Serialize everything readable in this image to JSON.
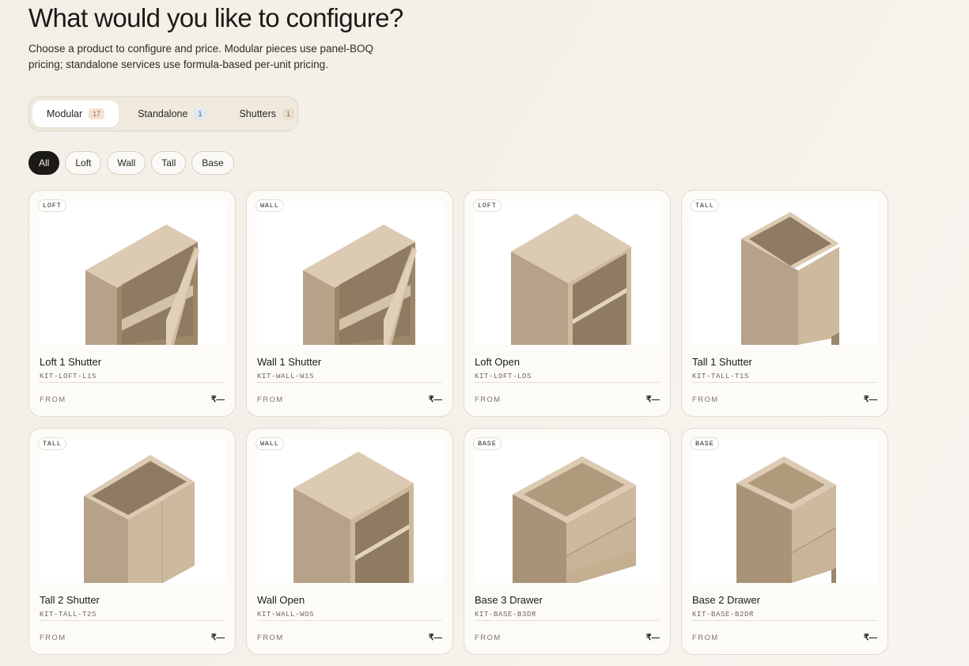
{
  "header": {
    "title": "What would you like to configure?",
    "subtitle": "Choose a product to configure and price. Modular pieces use panel-BOQ pricing; standalone services use formula-based per-unit pricing."
  },
  "tabs": [
    {
      "label": "Modular",
      "count": "17",
      "active": true
    },
    {
      "label": "Standalone",
      "count": "1",
      "active": false
    },
    {
      "label": "Shutters",
      "count": "1",
      "active": false
    }
  ],
  "filters": [
    {
      "label": "All",
      "active": true
    },
    {
      "label": "Loft",
      "active": false
    },
    {
      "label": "Wall",
      "active": false
    },
    {
      "label": "Tall",
      "active": false
    },
    {
      "label": "Base",
      "active": false
    }
  ],
  "products": [
    {
      "tag": "LOFT",
      "name": "Loft 1 Shutter",
      "sku": "KIT-LOFT-L1S",
      "from_label": "FROM",
      "price": "₹—",
      "icon": "cabinet-one-shutter-open"
    },
    {
      "tag": "WALL",
      "name": "Wall 1 Shutter",
      "sku": "KIT-WALL-W1S",
      "from_label": "FROM",
      "price": "₹—",
      "icon": "cabinet-one-shutter-open"
    },
    {
      "tag": "LOFT",
      "name": "Loft Open",
      "sku": "KIT-LOFT-LOS",
      "from_label": "FROM",
      "price": "₹—",
      "icon": "cabinet-open-shelves"
    },
    {
      "tag": "TALL",
      "name": "Tall 1 Shutter",
      "sku": "KIT-TALL-T1S",
      "from_label": "FROM",
      "price": "₹—",
      "icon": "cabinet-tall-one-shutter"
    },
    {
      "tag": "TALL",
      "name": "Tall 2 Shutter",
      "sku": "KIT-TALL-T2S",
      "from_label": "FROM",
      "price": "₹—",
      "icon": "cabinet-tall-two-shutter"
    },
    {
      "tag": "WALL",
      "name": "Wall Open",
      "sku": "KIT-WALL-WOS",
      "from_label": "FROM",
      "price": "₹—",
      "icon": "cabinet-open-shelves"
    },
    {
      "tag": "BASE",
      "name": "Base 3 Drawer",
      "sku": "KIT-BASE-B3DR",
      "from_label": "FROM",
      "price": "₹—",
      "icon": "cabinet-three-drawer"
    },
    {
      "tag": "BASE",
      "name": "Base 2 Drawer",
      "sku": "KIT-BASE-B2DR",
      "from_label": "FROM",
      "price": "₹—",
      "icon": "cabinet-two-drawer"
    }
  ],
  "colors": {
    "accent": "#1c1a17",
    "background": "#f3efe7",
    "wood_top": "#dccab3",
    "wood_left": "#b7a58a",
    "wood_right": "#cdb99d",
    "wood_inside": "#8f7b62"
  }
}
